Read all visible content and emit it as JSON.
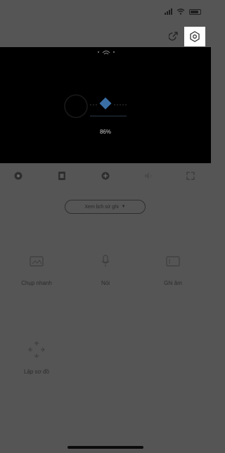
{
  "camera": {
    "firmware_percent": "86%"
  },
  "history": {
    "label": "Xem lịch sử ghi"
  },
  "features": [
    {
      "label": "Chụp nhanh",
      "icon": "photo-icon"
    },
    {
      "label": "Nói",
      "icon": "microphone-icon"
    },
    {
      "label": "Ghi âm",
      "icon": "recording-icon"
    },
    {
      "label": "Lập sơ đồ",
      "icon": "map-crosshair-icon"
    }
  ],
  "toolbar_icons": [
    "record-dot-icon",
    "sd-card-icon",
    "speed-icon",
    "audio-icon",
    "fullscreen-icon"
  ],
  "colors": {
    "overlay": "#555555",
    "highlight": "#ffffff",
    "camera_bg": "#000000"
  }
}
